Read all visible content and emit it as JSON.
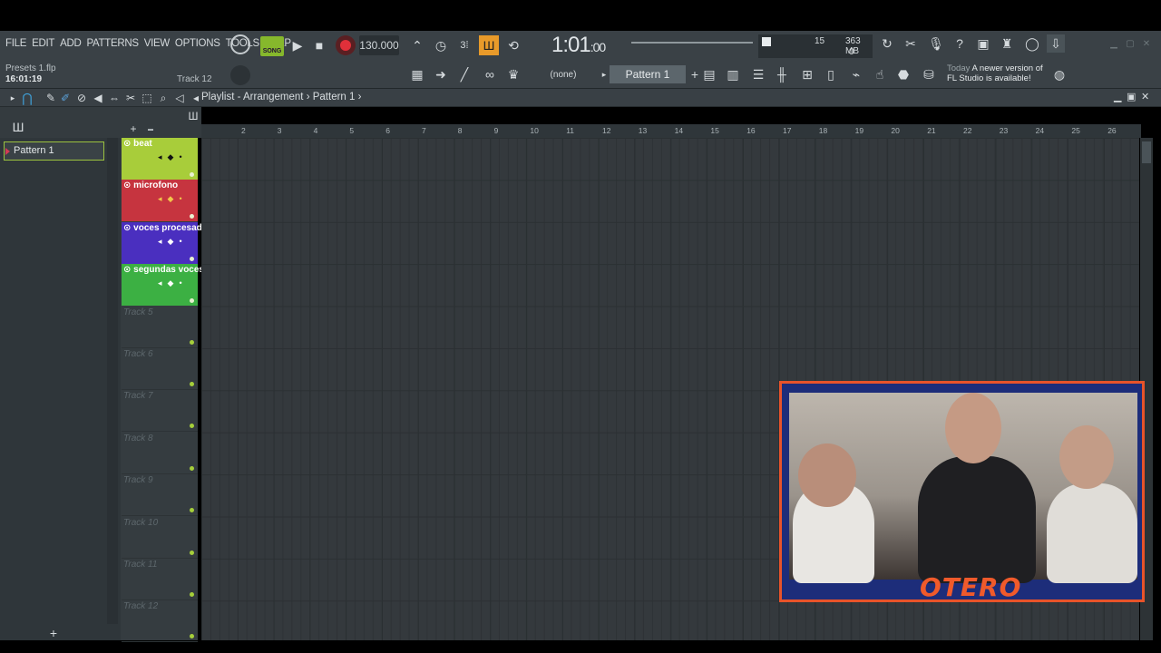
{
  "menu": [
    "FILE",
    "EDIT",
    "ADD",
    "PATTERNS",
    "VIEW",
    "OPTIONS",
    "TOOLS",
    "HELP"
  ],
  "transport": {
    "mode": "SONG",
    "tempo": "130.000",
    "time_main": "1:01",
    "time_sub": ":00"
  },
  "monitor": {
    "cpu": "15",
    "memory": "363 MB",
    "polyphony": "0"
  },
  "project": {
    "file": "Presets 1.flp",
    "clock": "16:01:19",
    "hint": "Track 12"
  },
  "selectors": {
    "channel": "(none)",
    "pattern": "Pattern 1"
  },
  "news": {
    "label": "Today",
    "line1": "A newer version of",
    "line2": "FL Studio is available!"
  },
  "playlist": {
    "title": "Playlist - Arrangement",
    "crumb": "Pattern 1"
  },
  "picker": {
    "items": [
      "Pattern 1"
    ]
  },
  "tracks": [
    {
      "name": "beat",
      "color": "#a8cd3a"
    },
    {
      "name": "microfono",
      "color": "#c6343f"
    },
    {
      "name": "voces procesadas",
      "color": "#4a2fbf"
    },
    {
      "name": "segundas voces",
      "color": "#3cb043"
    },
    {
      "name": "Track 5"
    },
    {
      "name": "Track 6"
    },
    {
      "name": "Track 7"
    },
    {
      "name": "Track 8"
    },
    {
      "name": "Track 9"
    },
    {
      "name": "Track 10"
    },
    {
      "name": "Track 11"
    },
    {
      "name": "Track 12"
    }
  ],
  "ruler": [
    "2",
    "3",
    "4",
    "5",
    "6",
    "7",
    "8",
    "9",
    "10",
    "11",
    "12",
    "13",
    "14",
    "15",
    "16",
    "17",
    "18",
    "19",
    "20",
    "21",
    "22",
    "23",
    "24",
    "25",
    "26"
  ],
  "webcam": {
    "logo": "OTERO"
  }
}
